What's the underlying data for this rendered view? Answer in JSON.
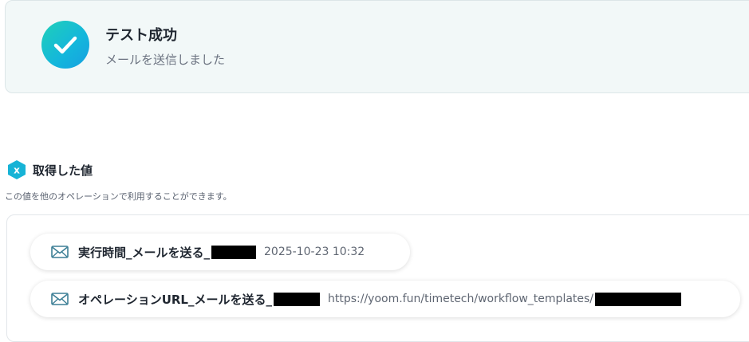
{
  "status": {
    "title": "テスト成功",
    "message": "メールを送信しました"
  },
  "values": {
    "heading": "取得した値",
    "icon_letter": "x",
    "description": "この値を他のオペレーションで利用することができます。",
    "items": [
      {
        "label": "実行時間_メールを送る_",
        "value": "2025-10-23 10:32"
      },
      {
        "label": "オペレーションURL_メールを送る_",
        "value": "https://yoom.fun/timetech/workflow_templates/"
      }
    ]
  },
  "colors": {
    "accent_teal": "#1fc3c9",
    "success_bg": "#f2f8f8",
    "redaction": "#000000"
  },
  "icons": {
    "status": "checkmark-icon",
    "values": "variable-hexagon-icon",
    "item": "mail-icon"
  }
}
